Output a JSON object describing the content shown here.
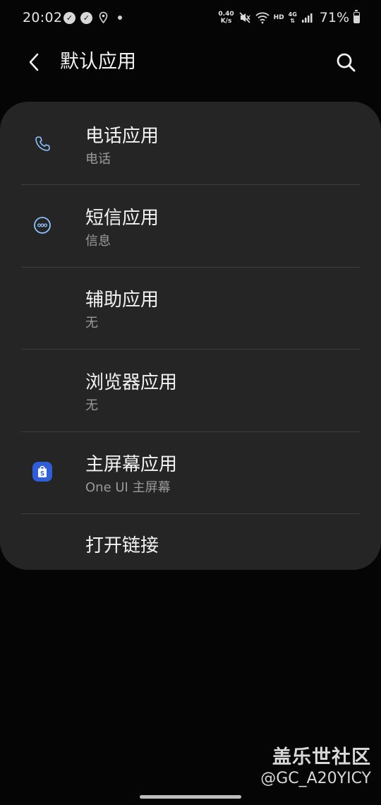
{
  "status_bar": {
    "time": "20:02",
    "net_speed_value": "0.40",
    "net_speed_unit": "K/s",
    "hd_label": "HD",
    "network_type": "4G",
    "battery_percent": "71%",
    "battery_level": 0.71
  },
  "app_bar": {
    "title": "默认应用"
  },
  "settings": {
    "items": [
      {
        "title": "电话应用",
        "subtitle": "电话",
        "icon": "phone-icon"
      },
      {
        "title": "短信应用",
        "subtitle": "信息",
        "icon": "messages-icon"
      },
      {
        "title": "辅助应用",
        "subtitle": "无"
      },
      {
        "title": "浏览器应用",
        "subtitle": "无"
      },
      {
        "title": "主屏幕应用",
        "subtitle": "One UI 主屏幕",
        "icon": "home-launcher-icon"
      },
      {
        "title": "打开链接"
      }
    ]
  },
  "watermark": {
    "title": "盖乐世社区",
    "handle": "@GC_A20YICY"
  },
  "colors": {
    "background": "#050505",
    "card": "#252525",
    "divider": "#3d3d3d",
    "accent_blue": "#2f5fd6",
    "icon_blue": "#8cc4ff",
    "subtitle_gray": "#9a9a9a"
  }
}
